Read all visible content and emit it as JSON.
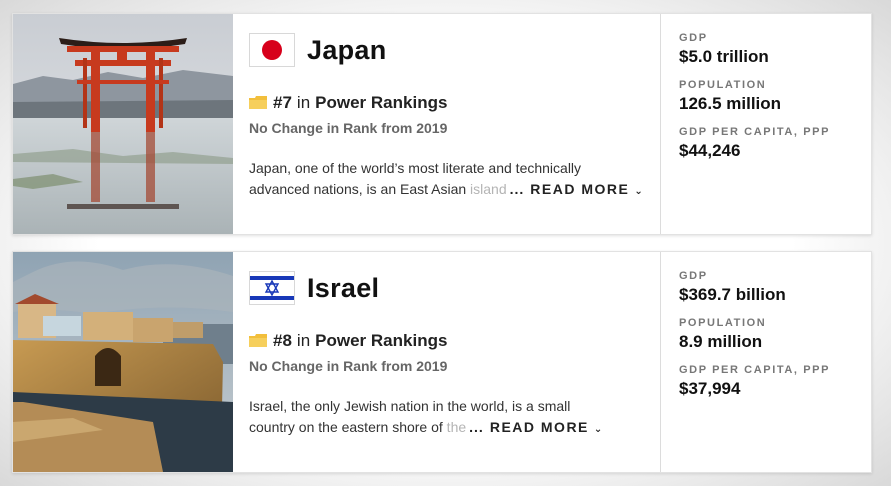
{
  "countries": [
    {
      "name": "Japan",
      "flag_icon": "japan-flag-icon",
      "rank": "#7",
      "rank_in": "in",
      "rank_list": "Power Rankings",
      "rank_change": "No Change in Rank from 2019",
      "desc_line1": "Japan, one of the world’s most literate and technically",
      "desc_line2": "advanced nations, is an East Asian",
      "desc_fade": " island",
      "stats": [
        {
          "label": "GDP",
          "value": "$5.0 trillion"
        },
        {
          "label": "POPULATION",
          "value": "126.5 million"
        },
        {
          "label": "GDP PER CAPITA, PPP",
          "value": "$44,246"
        }
      ]
    },
    {
      "name": "Israel",
      "flag_icon": "israel-flag-icon",
      "rank": "#8",
      "rank_in": "in",
      "rank_list": "Power Rankings",
      "rank_change": "No Change in Rank from 2019",
      "desc_line1": "Israel, the only Jewish nation in the world, is a small",
      "desc_line2": "country on the eastern shore of",
      "desc_fade": " the",
      "stats": [
        {
          "label": "GDP",
          "value": "$369.7 billion"
        },
        {
          "label": "POPULATION",
          "value": "8.9 million"
        },
        {
          "label": "GDP PER CAPITA, PPP",
          "value": "$37,994"
        }
      ]
    }
  ],
  "ui": {
    "ellipsis": "...",
    "read_more": "READ MORE",
    "chevron_icon": "chevron-down-icon",
    "folder_icon": "folder-icon"
  },
  "colors": {
    "japan_red": "#d7001b",
    "israel_blue": "#1838b8",
    "folder_yellow": "#f2bf3c"
  }
}
